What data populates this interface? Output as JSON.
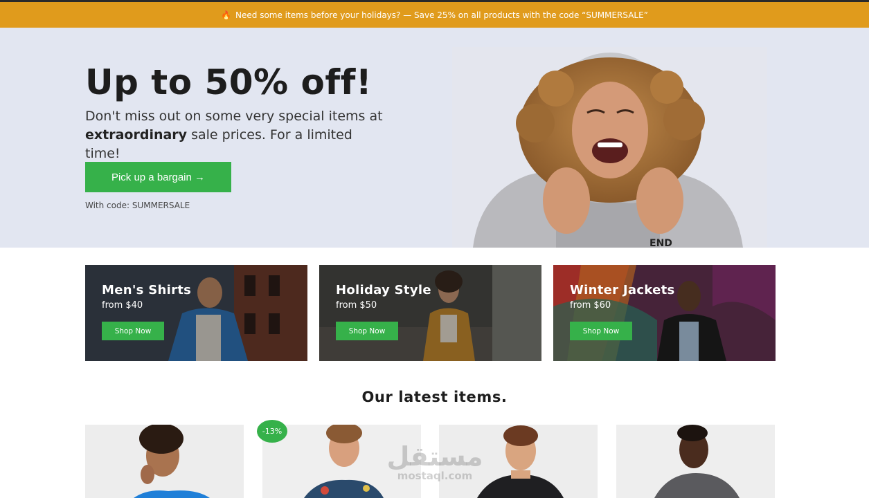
{
  "promo": {
    "icon": "flame-icon",
    "text": "Need some items before your holidays? — Save 25% on all products with the code “SUMMERSALE”"
  },
  "hero": {
    "title": "Up to 50% off!",
    "subtitle_before": "Don't miss out on some very special items at ",
    "subtitle_bold": "extraordinary",
    "subtitle_after": " sale prices. For a limited time!",
    "cta_label": "Pick up a bargain →",
    "code_text": "With code: SUMMERSALE"
  },
  "categories": [
    {
      "title": "Men's Shirts",
      "price": "from $40",
      "button": "Shop Now"
    },
    {
      "title": "Holiday Style",
      "price": "from $50",
      "button": "Shop Now"
    },
    {
      "title": "Winter Jackets",
      "price": "from $60",
      "button": "Shop Now"
    }
  ],
  "latest": {
    "heading": "Our latest items.",
    "discount_badge": "-13%"
  },
  "watermark": {
    "text": "مستقل",
    "sub": "mostaql.com"
  },
  "colors": {
    "promo_bg": "#e09b1c",
    "hero_bg": "#e2e6f1",
    "accent_green": "#36b14a"
  }
}
